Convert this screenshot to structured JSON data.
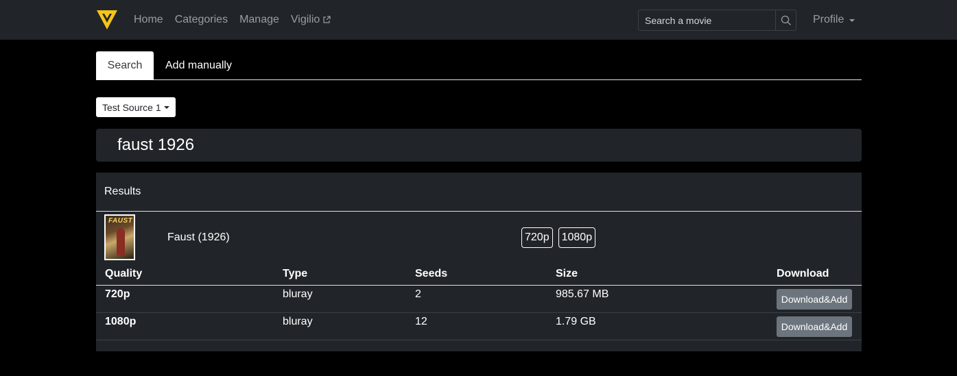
{
  "navbar": {
    "links": [
      "Home",
      "Categories",
      "Manage",
      "Vigilio"
    ],
    "search_placeholder": "Search a movie",
    "profile_label": "Profile",
    "logo_color": "#f5c518"
  },
  "tabs": [
    "Search",
    "Add manually"
  ],
  "source": {
    "selected": "Test Source 1"
  },
  "query": "faust 1926",
  "results": {
    "header": "Results",
    "poster_text": "FAUST",
    "movie": {
      "title": "Faust (1926)",
      "qualities": [
        "720p",
        "1080p"
      ]
    },
    "table": {
      "columns": [
        "Quality",
        "Type",
        "Seeds",
        "Size",
        "Download"
      ],
      "rows": [
        {
          "quality": "720p",
          "type": "bluray",
          "seeds": "2",
          "size": "985.67 MB",
          "action": "Download&Add"
        },
        {
          "quality": "1080p",
          "type": "bluray",
          "seeds": "12",
          "size": "1.79 GB",
          "action": "Download&Add"
        }
      ]
    }
  }
}
